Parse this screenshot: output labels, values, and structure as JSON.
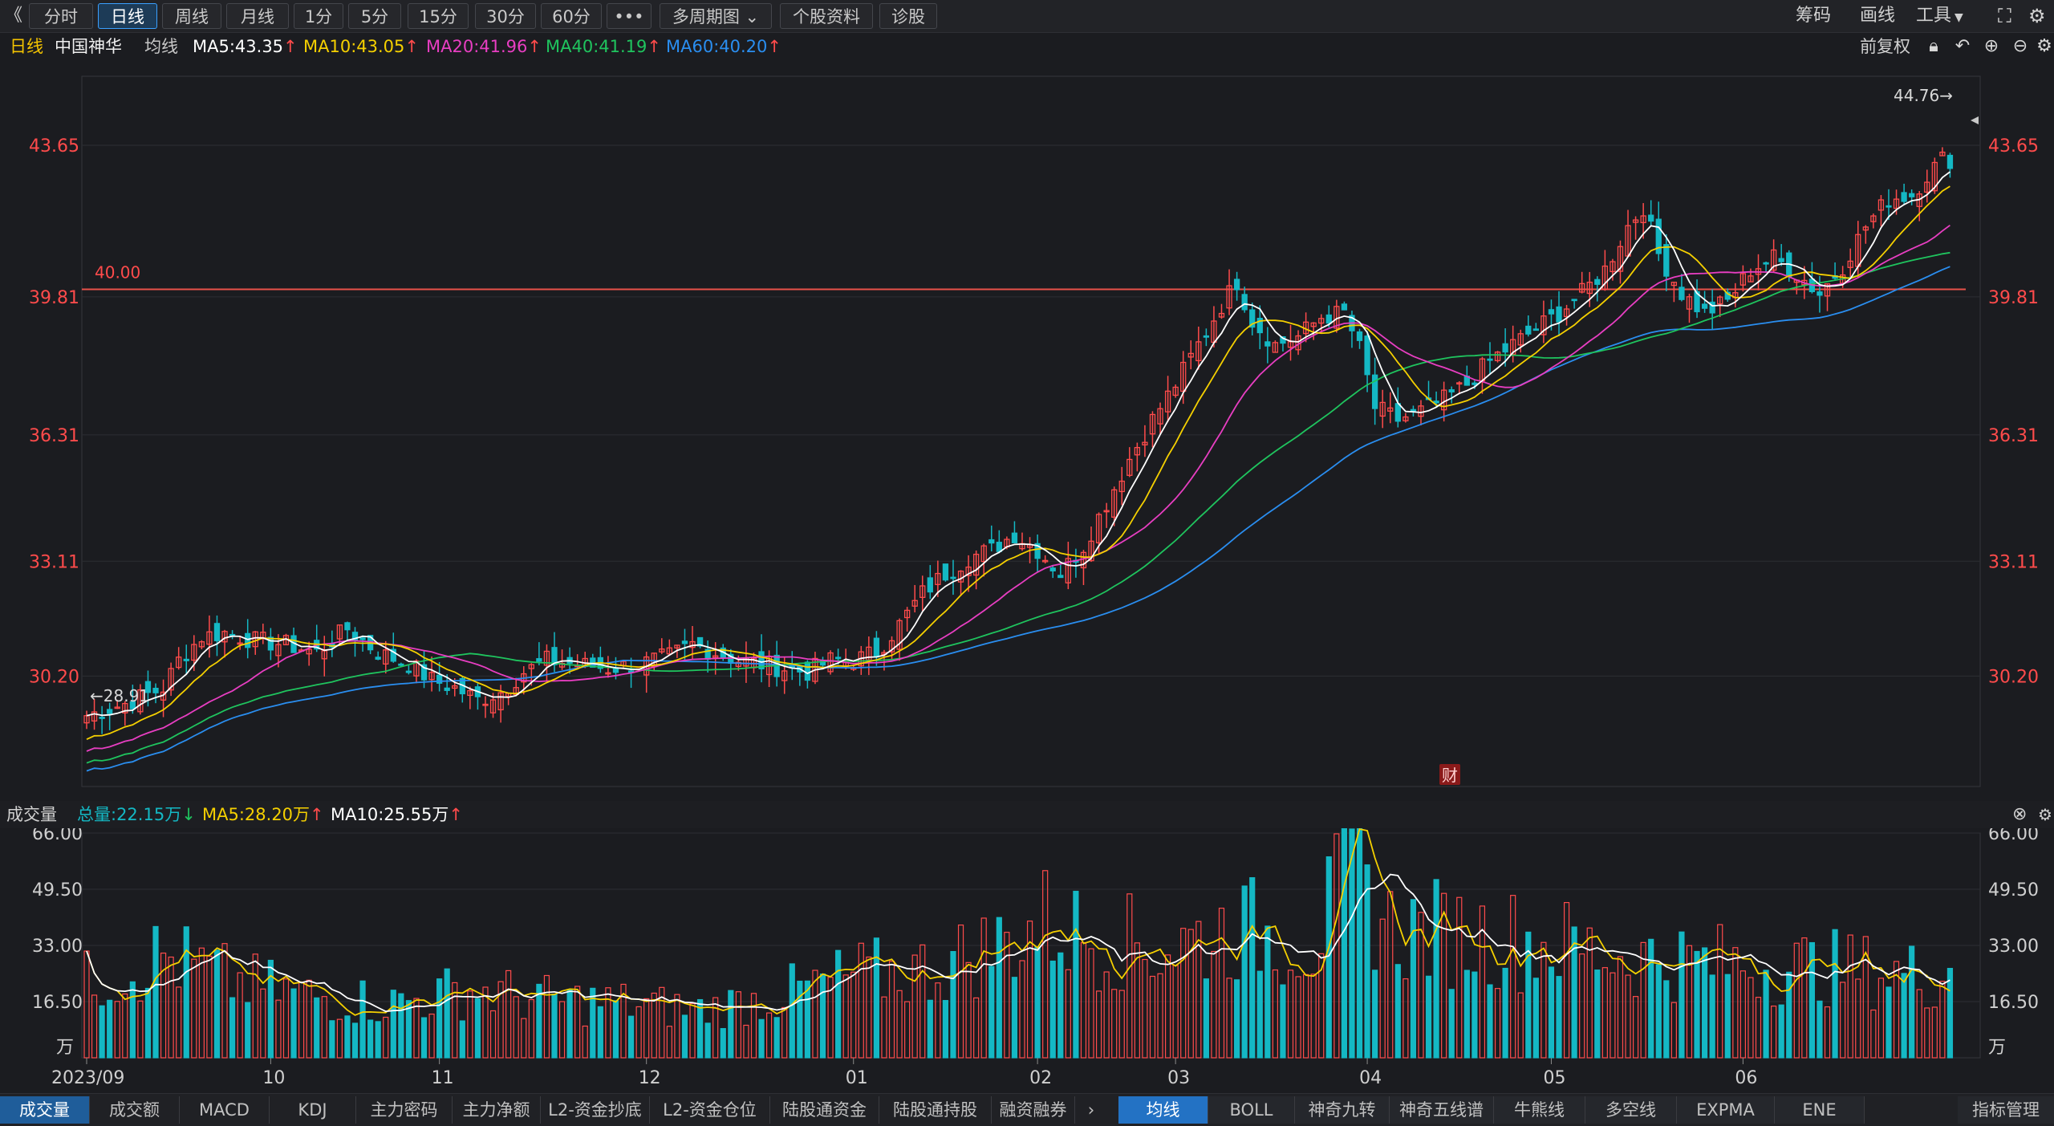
{
  "toolbar": {
    "back": "《",
    "buttons": [
      "分时",
      "日线",
      "周线",
      "月线",
      "1分",
      "5分",
      "15分",
      "30分",
      "60分",
      "•••",
      "多周期图",
      "个股资料",
      "诊股"
    ],
    "active": "日线",
    "right": [
      "筹码",
      "画线",
      "工具"
    ]
  },
  "info": {
    "period": "日线",
    "stock_name": "中国神华",
    "ma_label": "均线",
    "ma5": "MA5:43.35",
    "ma10": "MA10:43.05",
    "ma20": "MA20:41.96",
    "ma40": "MA40:41.19",
    "ma60": "MA60:40.20",
    "adjust": "前复权"
  },
  "colors": {
    "up": "#ff4b4b",
    "down": "#14b8c4",
    "ma5": "#ffffff",
    "ma10": "#f5d000",
    "ma20": "#e83ec2",
    "ma40": "#1fc45e",
    "ma60": "#2a8ef0",
    "grid": "#2d2e33"
  },
  "chart_data": [
    {
      "type": "candlestick",
      "name": "日线 中国神华",
      "y_ticks": [
        "43.65",
        "39.81",
        "36.31",
        "33.11",
        "30.20"
      ],
      "ylim": [
        27.4,
        45.4
      ],
      "x_ticks": [
        "2023/09",
        "10",
        "11",
        "12",
        "01",
        "02",
        "03",
        "04",
        "05",
        "06"
      ],
      "annotations": {
        "high_label": "44.76",
        "low_label": "28.91",
        "hline_label": "40.00",
        "hline_value": 40.0,
        "event_marker": "财"
      },
      "ma_last": {
        "MA5": 43.35,
        "MA10": 43.05,
        "MA20": 41.96,
        "MA40": 41.19,
        "MA60": 40.2
      },
      "close_keypoints": [
        [
          0,
          29.2
        ],
        [
          5,
          29.5
        ],
        [
          10,
          29.9
        ],
        [
          12,
          30.6
        ],
        [
          15,
          31.2
        ],
        [
          18,
          31.3
        ],
        [
          22,
          31.1
        ],
        [
          26,
          31.0
        ],
        [
          30,
          30.8
        ],
        [
          34,
          31.4
        ],
        [
          38,
          30.8
        ],
        [
          42,
          30.5
        ],
        [
          45,
          30.1
        ],
        [
          48,
          29.9
        ],
        [
          51,
          29.6
        ],
        [
          54,
          29.8
        ],
        [
          57,
          30.3
        ],
        [
          60,
          30.6
        ],
        [
          64,
          30.5
        ],
        [
          68,
          30.4
        ],
        [
          72,
          30.5
        ],
        [
          76,
          30.7
        ],
        [
          79,
          31.0
        ],
        [
          82,
          30.8
        ],
        [
          85,
          30.6
        ],
        [
          88,
          30.5
        ],
        [
          91,
          30.4
        ],
        [
          94,
          30.3
        ],
        [
          97,
          30.6
        ],
        [
          100,
          30.6
        ],
        [
          103,
          30.8
        ],
        [
          106,
          31.5
        ],
        [
          109,
          32.3
        ],
        [
          112,
          32.8
        ],
        [
          115,
          33.2
        ],
        [
          118,
          33.4
        ],
        [
          121,
          33.8
        ],
        [
          124,
          33.4
        ],
        [
          127,
          32.8
        ],
        [
          130,
          33.5
        ],
        [
          133,
          34.6
        ],
        [
          136,
          35.7
        ],
        [
          139,
          36.7
        ],
        [
          142,
          37.6
        ],
        [
          145,
          38.6
        ],
        [
          148,
          39.6
        ],
        [
          150,
          40.2
        ],
        [
          152,
          39.2
        ],
        [
          155,
          38.6
        ],
        [
          158,
          38.8
        ],
        [
          161,
          39.3
        ],
        [
          164,
          39.4
        ],
        [
          166,
          38.5
        ],
        [
          168,
          37.0
        ],
        [
          171,
          36.7
        ],
        [
          174,
          36.9
        ],
        [
          177,
          37.2
        ],
        [
          180,
          37.6
        ],
        [
          183,
          38.2
        ],
        [
          186,
          38.6
        ],
        [
          189,
          39.0
        ],
        [
          192,
          39.4
        ],
        [
          195,
          39.9
        ],
        [
          198,
          40.5
        ],
        [
          201,
          41.6
        ],
        [
          203,
          42.1
        ],
        [
          205,
          40.9
        ],
        [
          208,
          39.9
        ],
        [
          211,
          39.4
        ],
        [
          214,
          39.7
        ],
        [
          217,
          40.5
        ],
        [
          220,
          40.8
        ],
        [
          223,
          40.4
        ],
        [
          226,
          39.9
        ],
        [
          229,
          40.6
        ],
        [
          232,
          41.6
        ],
        [
          235,
          42.3
        ],
        [
          238,
          42.4
        ],
        [
          240,
          42.9
        ],
        [
          242,
          43.3
        ]
      ]
    },
    {
      "type": "bar",
      "name": "成交量",
      "unit": "万",
      "y_ticks": [
        "66.00",
        "49.50",
        "33.00",
        "16.50",
        "万"
      ],
      "ylim": [
        0,
        66
      ],
      "last": {
        "总量": "22.15万",
        "MA5": "28.20万",
        "MA10": "25.55万"
      },
      "volume_keypoints": [
        [
          0,
          22
        ],
        [
          10,
          30
        ],
        [
          20,
          22
        ],
        [
          30,
          18
        ],
        [
          40,
          16
        ],
        [
          50,
          20
        ],
        [
          60,
          17
        ],
        [
          70,
          16
        ],
        [
          80,
          14
        ],
        [
          90,
          18
        ],
        [
          100,
          24
        ],
        [
          110,
          26
        ],
        [
          120,
          34
        ],
        [
          125,
          40
        ],
        [
          130,
          36
        ],
        [
          140,
          32
        ],
        [
          150,
          38
        ],
        [
          160,
          34
        ],
        [
          165,
          55
        ],
        [
          170,
          38
        ],
        [
          180,
          36
        ],
        [
          190,
          34
        ],
        [
          200,
          30
        ],
        [
          210,
          28
        ],
        [
          220,
          27
        ],
        [
          230,
          26
        ],
        [
          240,
          24
        ],
        [
          243,
          26
        ]
      ]
    }
  ],
  "volume_bar": {
    "label": "成交量",
    "total": "总量:22.15万",
    "ma5": "MA5:28.20万",
    "ma10": "MA10:25.55万"
  },
  "bottom_tabs": [
    "成交量",
    "成交额",
    "MACD",
    "KDJ",
    "主力密码",
    "主力净额",
    "L2-资金抄底",
    "L2-资金仓位",
    "陆股通资金",
    "陆股通持股",
    "融资融券"
  ],
  "bottom_active": "成交量",
  "more_arrow": "›",
  "indicator_tabs": [
    "均线",
    "BOLL",
    "神奇九转",
    "神奇五线谱",
    "牛熊线",
    "多空线",
    "EXPMA",
    "ENE"
  ],
  "indicator_active": "均线",
  "indicator_manage": "指标管理",
  "icons": [
    "lock-icon",
    "undo-icon",
    "zoom-in-icon",
    "zoom-out-icon",
    "settings-icon",
    "close-icon",
    "fullscreen-icon"
  ]
}
